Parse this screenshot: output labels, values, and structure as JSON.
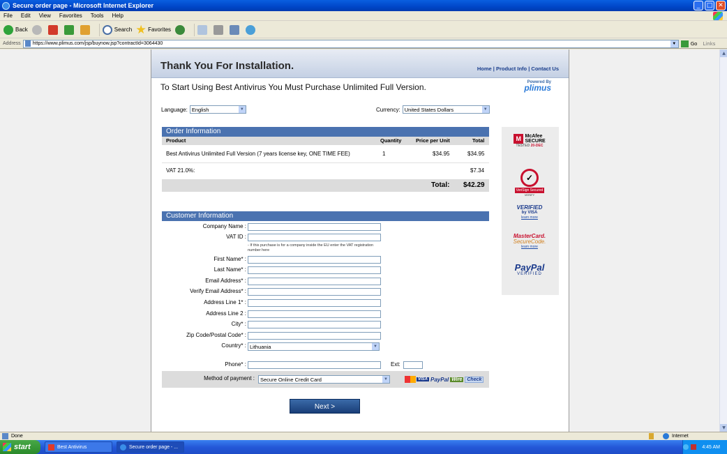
{
  "window": {
    "title": "Secure order page - Microsoft Internet Explorer",
    "buttons": {
      "minimize": "_",
      "maximize": "□",
      "close": "✕"
    }
  },
  "menu": [
    "File",
    "Edit",
    "View",
    "Favorites",
    "Tools",
    "Help"
  ],
  "toolbar": {
    "back": "Back",
    "search": "Search",
    "favorites": "Favorites"
  },
  "address": {
    "label": "Address",
    "url": "https://www.plimus.com/jsp/buynow.jsp?contractId=3064430",
    "go": "Go",
    "links": "Links"
  },
  "page": {
    "header_title": "Thank You For Installation.",
    "nav": {
      "home": "Home",
      "product_info": "Product Info",
      "contact_us": "Contact Us",
      "sep": " | "
    },
    "subtitle": "To Start Using Best Antivirus You Must Purchase Unlimited Full Version.",
    "powered_by": "Powered By",
    "brand": "plimus",
    "language_label": "Language:",
    "language_value": "English",
    "currency_label": "Currency:",
    "currency_value": "United States Dollars",
    "order": {
      "title": "Order Information",
      "col_product": "Product",
      "col_quantity": "Quantity",
      "col_price": "Price per Unit",
      "col_total": "Total",
      "item_name": "Best Antivirus Unlimited Full Version (7 years license key, ONE TIME FEE)",
      "item_qty": "1",
      "item_price": "$34.95",
      "item_total": "$34.95",
      "vat_label": "VAT 21.0%:",
      "vat_value": "$7.34",
      "total_label": "Total:",
      "total_value": "$42.29"
    },
    "customer": {
      "title": "Customer Information",
      "company": "Company Name :",
      "vat_id": "VAT ID :",
      "vat_note": "- If this purchase is for a company inside the EU enter the VAT registration number here",
      "first_name": "First Name* :",
      "last_name": "Last Name* :",
      "email": "Email Address* :",
      "verify_email": "Verify Email Address* :",
      "address1": "Address Line 1* :",
      "address2": "Address Line 2 :",
      "city": "City* :",
      "zip": "Zip Code/Postal Code* :",
      "country": "Country* :",
      "country_value": "Lithuania",
      "phone": "Phone* :",
      "ext": "Ext:",
      "payment_label": "Method of payment :",
      "payment_value": "Secure Online Credit Card"
    },
    "payment_logos": {
      "visa": "VISA",
      "paypal": "PayPal",
      "wire": "Wire",
      "check": "Check"
    },
    "next_button": "Next >",
    "seals": {
      "mcafee_name": "McAfee",
      "mcafee_secure": "SECURE",
      "mcafee_tested": "TESTED",
      "mcafee_date": "20-DEC",
      "verisign_name": "VeriSign Secured",
      "verisign_verify": "VERIFY",
      "vbv_verified": "VERIFIED",
      "vbv_by": "by VISA",
      "vbv_learn": "learn more",
      "mc_name": "MasterCard.",
      "mc_sub": "SecureCode.",
      "mc_learn": "learn more",
      "pp_name": "PayPal",
      "pp_verified": "VERIFIED"
    }
  },
  "status": {
    "text": "Done",
    "zone": "Internet"
  },
  "taskbar": {
    "start": "start",
    "tasks": [
      "Best Antivirus",
      "Secure order page - ..."
    ],
    "clock": "4:45 AM"
  },
  "colors": {
    "section_header": "#4a72b0",
    "nav_link": "#1a3e8c",
    "taskbar": "#2458d8"
  }
}
